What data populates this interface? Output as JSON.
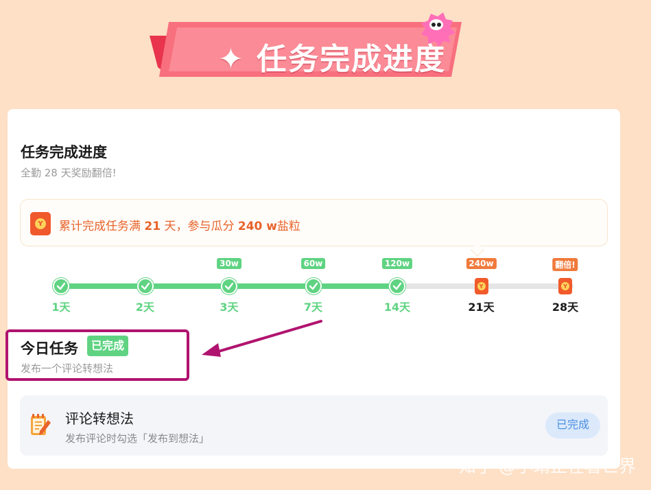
{
  "banner": {
    "title": "✦ 任务完成进度"
  },
  "card": {
    "title": "任务完成进度",
    "subtitle": "全勤 28 天奖励翻倍!"
  },
  "notice": {
    "prefix": "累计完成任务满 ",
    "days": "21",
    "middle": " 天，参与瓜分 ",
    "amount": "240 w",
    "suffix": "盐粒",
    "icon": "coin-packet-icon"
  },
  "timeline": {
    "progress_steps_completed": 5,
    "steps": [
      {
        "label": "1天",
        "badge": "",
        "status": "completed"
      },
      {
        "label": "2天",
        "badge": "",
        "status": "completed"
      },
      {
        "label": "3天",
        "badge": "30w",
        "status": "completed"
      },
      {
        "label": "7天",
        "badge": "60w",
        "status": "completed"
      },
      {
        "label": "14天",
        "badge": "120w",
        "status": "completed"
      },
      {
        "label": "21天",
        "badge": "240w",
        "status": "pending"
      },
      {
        "label": "28天",
        "badge": "翻倍!",
        "status": "pending"
      }
    ]
  },
  "today": {
    "title": "今日任务",
    "badge": "已完成",
    "subtitle": "发布一个评论转想法"
  },
  "task": {
    "name": "评论转想法",
    "desc": "发布评论时勾选「发布到想法」",
    "status": "已完成",
    "icon": "notepad-pencil-icon"
  },
  "watermark": "知乎 @小靖正在看世界",
  "colors": {
    "background": "#fde0c6",
    "green": "#5fd382",
    "orange": "#f07a3c",
    "annotation": "#b0136f",
    "banner_pink": "#f86f7e"
  }
}
